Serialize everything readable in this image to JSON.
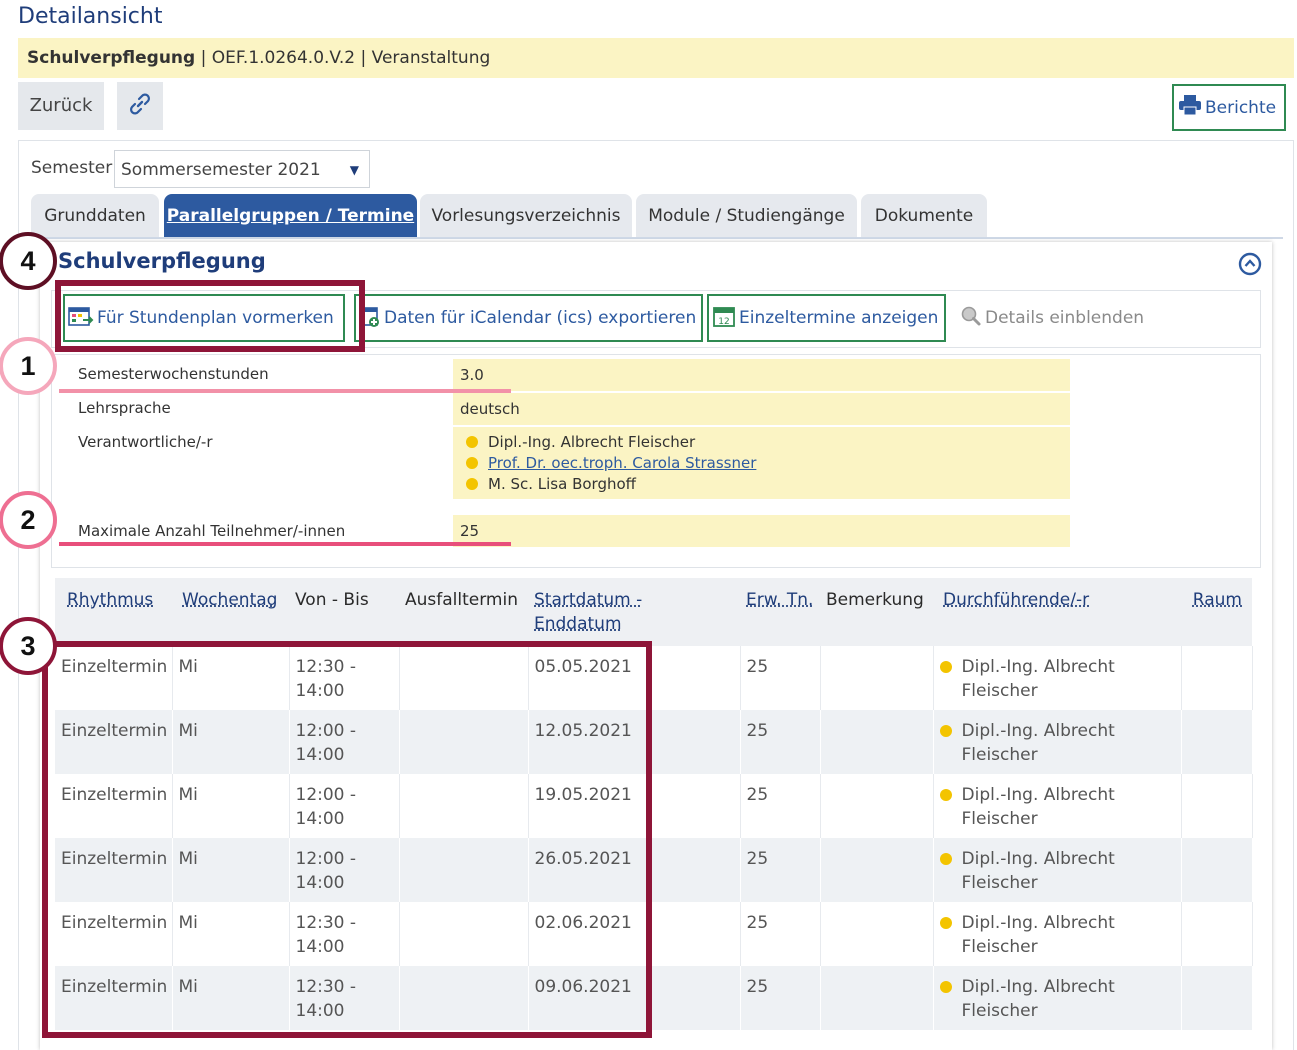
{
  "page_title": "Detailansicht",
  "info": {
    "name": "Schulverpflegung",
    "code": "OEF.1.0264.0.V.2",
    "type": "Veranstaltung",
    "sep": "|"
  },
  "toolbar": {
    "back_label": "Zurück",
    "reports_label": "Berichte"
  },
  "semester": {
    "label": "Semester",
    "selected": "Sommersemester 2021"
  },
  "tabs": [
    "Grunddaten",
    "Parallelgruppen / Termine",
    "Vorlesungsverzeichnis",
    "Module / Studiengänge",
    "Dokumente"
  ],
  "section": {
    "title": "Schulverpflegung",
    "actions": [
      "Für Stundenplan vormerken",
      "Daten für iCalendar (ics) exportieren",
      "Einzeltermine anzeigen",
      "Details einblenden"
    ]
  },
  "details": {
    "sws_label": "Semesterwochenstunden",
    "sws_value": "3.0",
    "language_label": "Lehrsprache",
    "language_value": "deutsch",
    "responsible_label": "Verantwortliche/-r",
    "responsible": [
      "Dipl.-Ing. Albrecht Fleischer",
      "Prof. Dr. oec.troph. Carola Strassner",
      "M. Sc. Lisa Borghoff"
    ],
    "max_label": "Maximale Anzahl Teilnehmer/-innen",
    "max_value": "25"
  },
  "annotations": [
    "1",
    "2",
    "3",
    "4"
  ],
  "schedule": {
    "headers": [
      "Rhythmus",
      "Wochentag",
      "Von - Bis",
      "Ausfalltermin",
      "Startdatum - Enddatum",
      "Erw. Tn.",
      "Bemerkung",
      "Durchführende/-r",
      "Raum"
    ],
    "rows": [
      {
        "rhythm": "Einzeltermin",
        "day": "Mi",
        "from": "12:30 -",
        "to": "14:00",
        "cancel": "",
        "date": "05.05.2021",
        "exp": "25",
        "note": "",
        "perf1": "Dipl.-Ing. Albrecht",
        "perf2": "Fleischer",
        "room": ""
      },
      {
        "rhythm": "Einzeltermin",
        "day": "Mi",
        "from": "12:00 -",
        "to": "14:00",
        "cancel": "",
        "date": "12.05.2021",
        "exp": "25",
        "note": "",
        "perf1": "Dipl.-Ing. Albrecht",
        "perf2": "Fleischer",
        "room": ""
      },
      {
        "rhythm": "Einzeltermin",
        "day": "Mi",
        "from": "12:00 -",
        "to": "14:00",
        "cancel": "",
        "date": "19.05.2021",
        "exp": "25",
        "note": "",
        "perf1": "Dipl.-Ing. Albrecht",
        "perf2": "Fleischer",
        "room": ""
      },
      {
        "rhythm": "Einzeltermin",
        "day": "Mi",
        "from": "12:00 -",
        "to": "14:00",
        "cancel": "",
        "date": "26.05.2021",
        "exp": "25",
        "note": "",
        "perf1": "Dipl.-Ing. Albrecht",
        "perf2": "Fleischer",
        "room": ""
      },
      {
        "rhythm": "Einzeltermin",
        "day": "Mi",
        "from": "12:30 -",
        "to": "14:00",
        "cancel": "",
        "date": "02.06.2021",
        "exp": "25",
        "note": "",
        "perf1": "Dipl.-Ing. Albrecht",
        "perf2": "Fleischer",
        "room": ""
      },
      {
        "rhythm": "Einzeltermin",
        "day": "Mi",
        "from": "12:30 -",
        "to": "14:00",
        "cancel": "",
        "date": "09.06.2021",
        "exp": "25",
        "note": "",
        "perf1": "Dipl.-Ing. Albrecht",
        "perf2": "Fleischer",
        "room": ""
      }
    ]
  },
  "colors": {
    "brand_blue": "#2d5aa0",
    "accent_green": "#2f8a52",
    "highlight_yellow": "#fbf4c4",
    "annotation_red": "#8e1538",
    "annotation_pink": "#e84f7b"
  }
}
